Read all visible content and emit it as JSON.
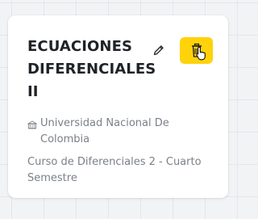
{
  "course_card": {
    "title": "ECUACIONES DIFERENCIALES II",
    "university": "Universidad Nacional De Colombia",
    "description": "Curso de Diferenciales 2 - Cuarto Semestre",
    "icons": {
      "edit": "pencil-icon",
      "delete": "trash-icon",
      "university": "building-icon",
      "cursor": "hand-pointer-cursor"
    },
    "colors": {
      "delete_button": "#ffd20a",
      "title": "#1f2328",
      "muted_text": "#7b8088"
    }
  }
}
